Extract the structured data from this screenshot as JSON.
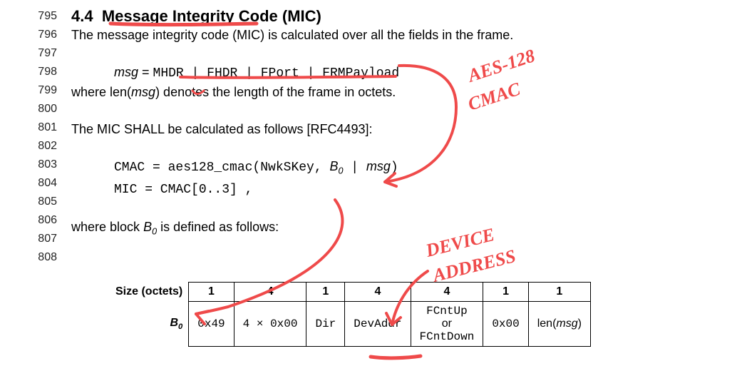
{
  "section": {
    "number": "4.4",
    "title": "Message Integrity Code (MIC)"
  },
  "line_numbers": [
    "795",
    "796",
    "797",
    "798",
    "799",
    "800",
    "801",
    "802",
    "803",
    "804",
    "805",
    "806",
    "807",
    "808"
  ],
  "body": {
    "intro": "The message integrity code (MIC) is calculated over all the fields in the frame.",
    "msg_lhs": "msg",
    "msg_eq": " = ",
    "msg_rhs": "MHDR | FHDR | FPort | FRMPayload",
    "where_len_pre": "where len(",
    "where_len_msg": "msg",
    "where_len_post": ") denotes the length of the frame in octets.",
    "mic_shall": "The MIC SHALL be calculated as follows [RFC4493]:",
    "cmac_line_pre": "CMAC = aes128_cmac(NwkSKey, ",
    "cmac_B0": "B",
    "cmac_B0_sub": "0",
    "cmac_mid": " | ",
    "cmac_msg": "msg",
    "cmac_end": ")",
    "mic_line": "MIC = CMAC[0..3] ,",
    "where_block_pre": "where block ",
    "where_block_B": "B",
    "where_block_sub": "0",
    "where_block_post": " is defined as follows:"
  },
  "table": {
    "row_label_size": "Size (octets)",
    "row_label_B0": "B",
    "row_label_B0_sub": "0",
    "sizes": [
      "1",
      "4",
      "1",
      "4",
      "4",
      "1",
      "1"
    ],
    "cells": {
      "c0": "0x49",
      "c1": "4 × 0x00",
      "c2": "Dir",
      "c3": "DevAddr",
      "c4a": "FCntUp",
      "c4_or": "or",
      "c4b": "FCntDown",
      "c5": "0x00",
      "c6_pre": "len(",
      "c6_msg": "msg",
      "c6_post": ")"
    }
  },
  "annotations": {
    "aes": "AES-128",
    "cmac": "CMAC",
    "device": "DEVICE",
    "address": "ADDRESS"
  }
}
